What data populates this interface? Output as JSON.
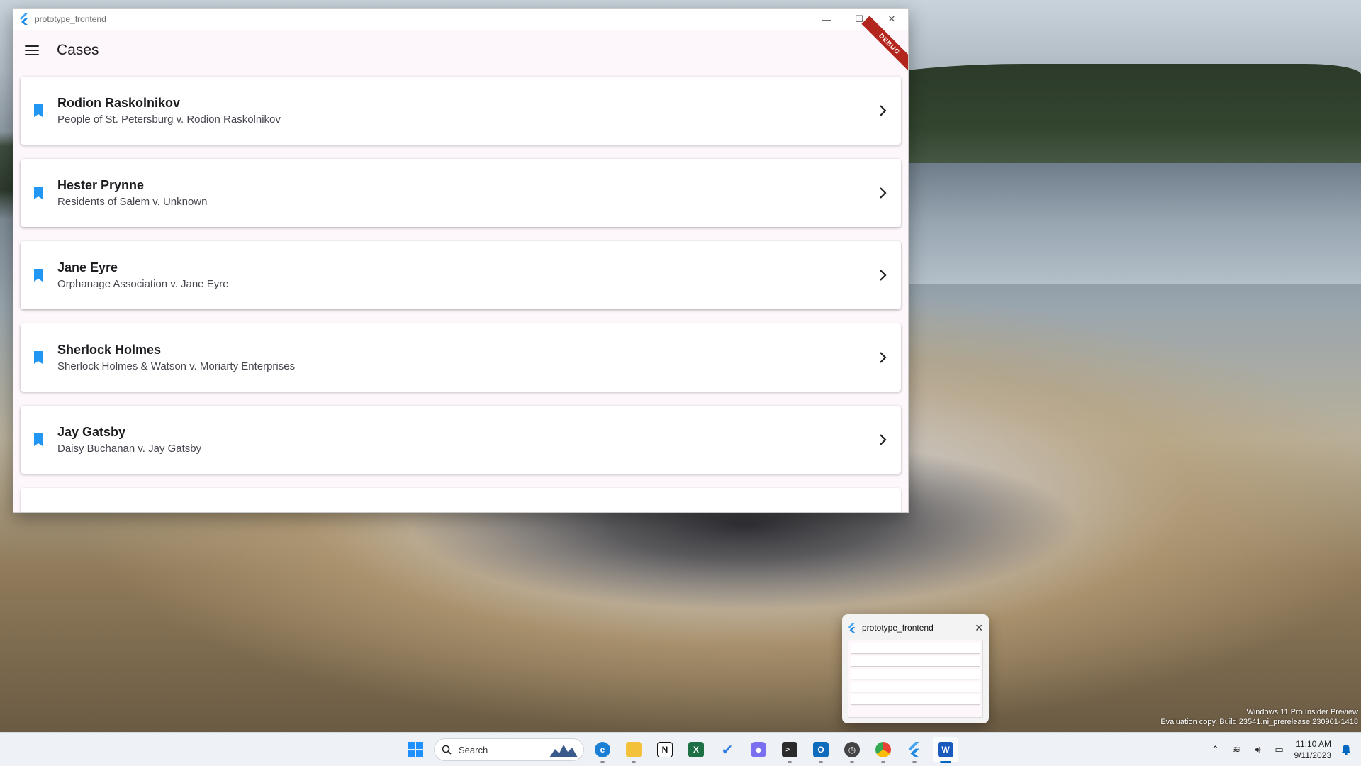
{
  "window": {
    "title": "prototype_frontend",
    "minimize_glyph": "—",
    "maximize_glyph": "☐",
    "close_glyph": "✕"
  },
  "app_bar": {
    "title": "Cases",
    "debug_label": "DEBUG"
  },
  "cases": [
    {
      "name": "Rodion Raskolnikov",
      "subtitle": "People of St. Petersburg v. Rodion Raskolnikov"
    },
    {
      "name": "Hester Prynne",
      "subtitle": "Residents of Salem v. Unknown"
    },
    {
      "name": "Jane Eyre",
      "subtitle": "Orphanage Association v. Jane Eyre"
    },
    {
      "name": "Sherlock Holmes",
      "subtitle": "Sherlock Holmes & Watson v. Moriarty Enterprises"
    },
    {
      "name": "Jay Gatsby",
      "subtitle": "Daisy Buchanan v. Jay Gatsby"
    }
  ],
  "preview": {
    "title": "prototype_frontend",
    "close_glyph": "✕"
  },
  "watermark": {
    "line1": "Windows 11 Pro Insider Preview",
    "line2": "Evaluation copy. Build 23541.ni_prerelease.230901-1418"
  },
  "taskbar": {
    "search_placeholder": "Search",
    "apps": [
      "start",
      "search",
      "edge-beta",
      "file-explorer",
      "notion",
      "excel",
      "todo",
      "copilot",
      "terminal",
      "outlook",
      "clock",
      "chrome",
      "flutter",
      "word"
    ],
    "clock_time": "11:10 AM",
    "clock_date": "9/11/2023"
  },
  "colors": {
    "accent": "#2196f3",
    "debug_banner": "#b3261e",
    "app_background": "#fdf7fb"
  }
}
